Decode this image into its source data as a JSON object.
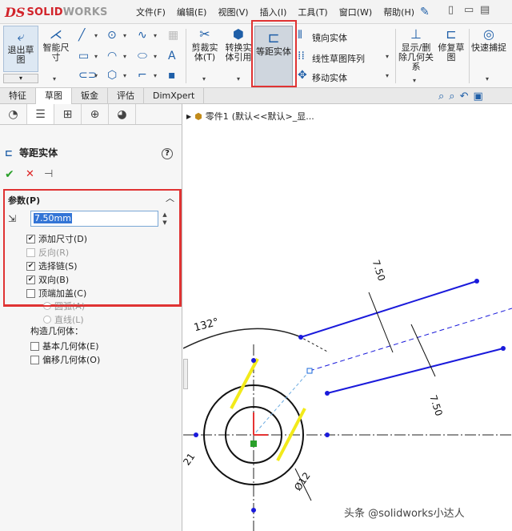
{
  "app": {
    "logo_mark": "DS",
    "logo_word": "SOLID",
    "logo_word2": "WORKS"
  },
  "menu": [
    "文件(F)",
    "编辑(E)",
    "视图(V)",
    "插入(I)",
    "工具(T)",
    "窗口(W)",
    "帮助(H)"
  ],
  "ribbon": {
    "exit_sketch": "退出草图",
    "smart_dim": "智能尺寸",
    "trim": "剪裁实体(T)",
    "convert": "转换实体引用",
    "offset": "等距实体",
    "mirror": "镜向实体",
    "linear_pattern": "线性草图阵列",
    "move": "移动实体",
    "show_relations": "显示/删除几何关系",
    "repair": "修复草图",
    "quick_snap": "快速捕捉"
  },
  "tabs": [
    "特征",
    "草图",
    "钣金",
    "评估",
    "DimXpert"
  ],
  "active_tab": "草图",
  "property_manager": {
    "title": "等距实体",
    "params_header": "参数(P)",
    "distance": "7.50mm",
    "options": [
      {
        "label": "添加尺寸(D)",
        "checked": true,
        "enabled": true
      },
      {
        "label": "反向(R)",
        "checked": false,
        "enabled": false
      },
      {
        "label": "选择链(S)",
        "checked": true,
        "enabled": true
      },
      {
        "label": "双向(B)",
        "checked": true,
        "enabled": true
      },
      {
        "label": "顶端加盖(C)",
        "checked": false,
        "enabled": true
      }
    ],
    "cap_options": [
      "圆弧(A)",
      "直线(L)"
    ],
    "construct_header": "构造几何体：",
    "construct_options": [
      "基本几何体(E)",
      "偏移几何体(O)"
    ]
  },
  "tree": {
    "part": "零件1",
    "config": "(默认<<默认>_显..."
  },
  "drawing": {
    "dims": [
      "7.50",
      "7.50",
      "132°",
      "Ø12",
      "21"
    ]
  },
  "watermark": "头条 @solidworks小达人",
  "colors": {
    "accent": "#1f5fa8",
    "highlight": "#e03333",
    "sketch_blue": "#1a1adb",
    "yellow": "#f2ea1a"
  }
}
